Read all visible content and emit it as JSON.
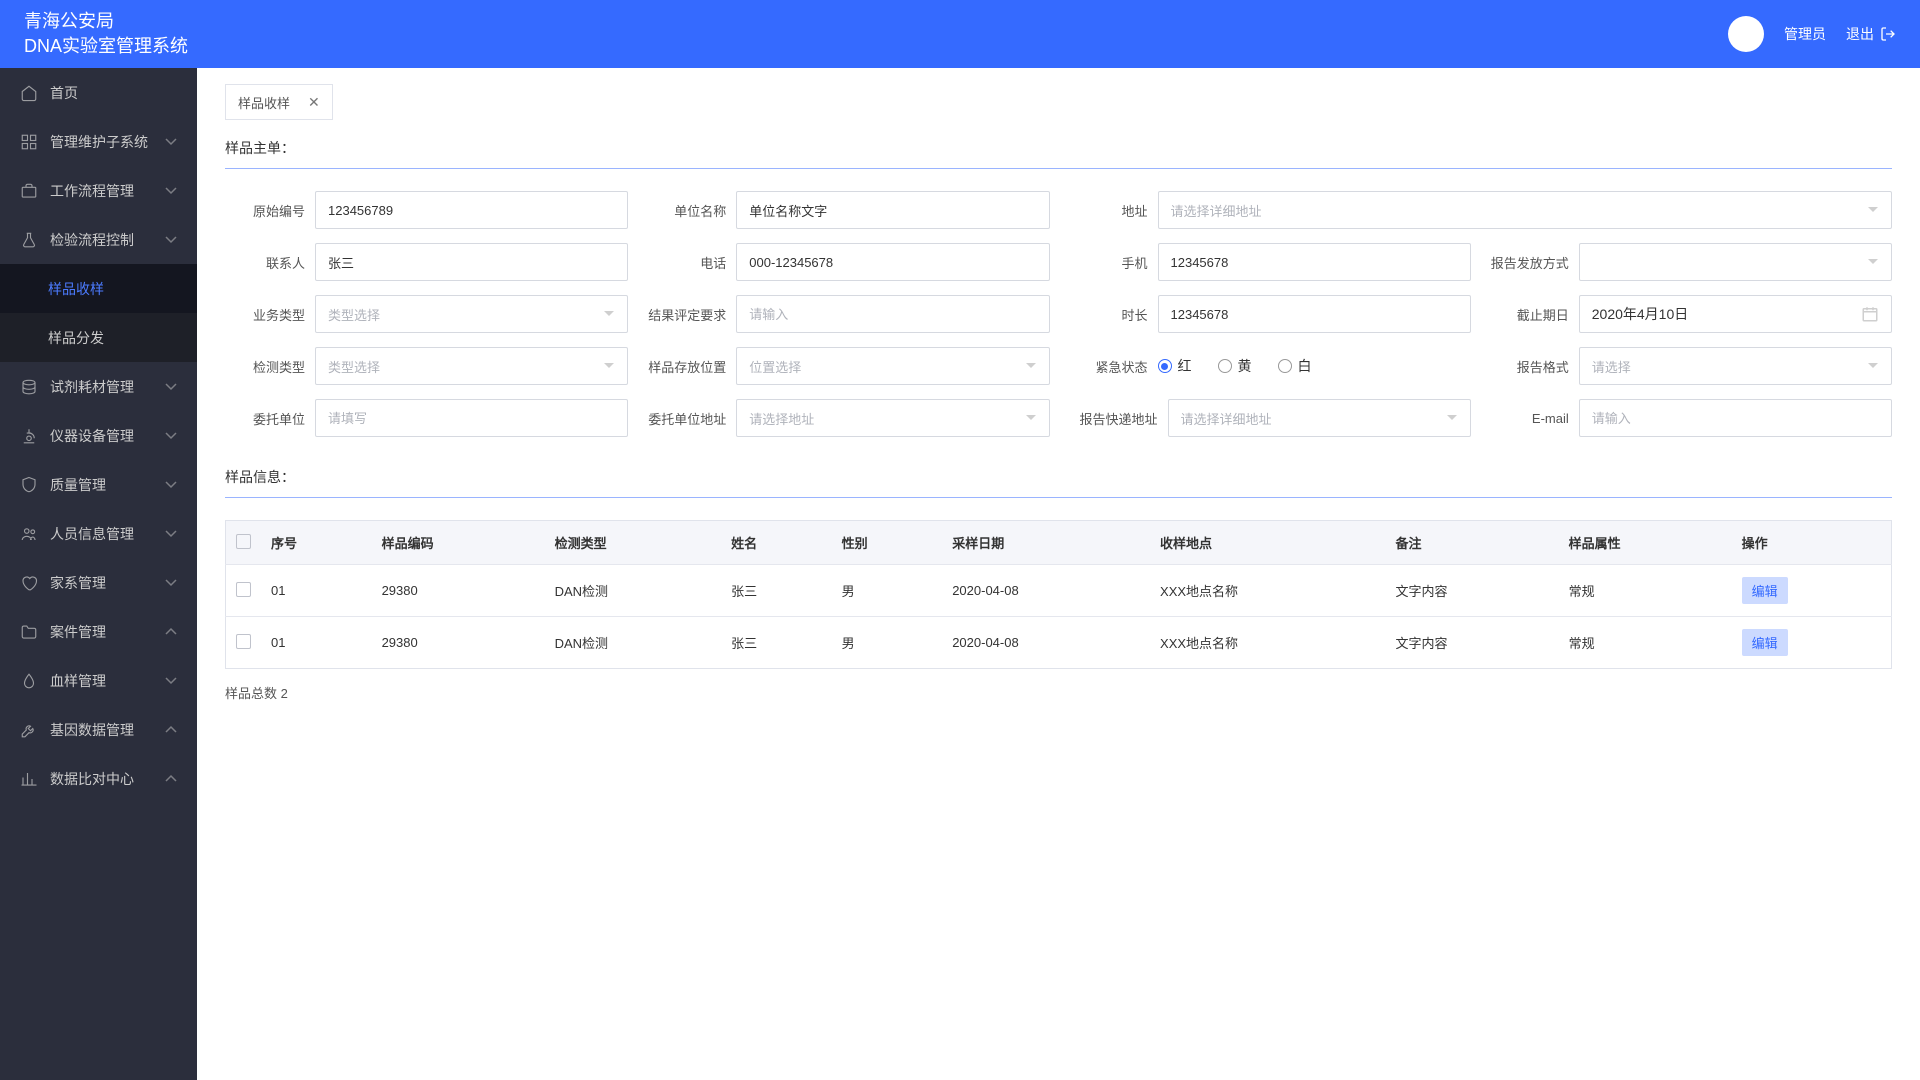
{
  "header": {
    "title_line1": "青海公安局",
    "title_line2": "DNA实验室管理系统",
    "user_role": "管理员",
    "logout": "退出"
  },
  "sidebar": {
    "items": [
      {
        "label": "首页",
        "icon": "home",
        "expandable": false
      },
      {
        "label": "管理维护子系统",
        "icon": "grid",
        "expandable": true,
        "chevron": "down"
      },
      {
        "label": "工作流程管理",
        "icon": "briefcase",
        "expandable": true,
        "chevron": "down"
      },
      {
        "label": "检验流程控制",
        "icon": "flask",
        "expandable": true,
        "chevron": "down",
        "expanded": true,
        "children": [
          {
            "label": "样品收样",
            "active": true
          },
          {
            "label": "样品分发"
          }
        ]
      },
      {
        "label": "试剂耗材管理",
        "icon": "stack",
        "expandable": true,
        "chevron": "down"
      },
      {
        "label": "仪器设备管理",
        "icon": "microscope",
        "expandable": true,
        "chevron": "down"
      },
      {
        "label": "质量管理",
        "icon": "shield",
        "expandable": true,
        "chevron": "down"
      },
      {
        "label": "人员信息管理",
        "icon": "users",
        "expandable": true,
        "chevron": "down"
      },
      {
        "label": "家系管理",
        "icon": "heart",
        "expandable": true,
        "chevron": "down"
      },
      {
        "label": "案件管理",
        "icon": "folder",
        "expandable": true,
        "chevron": "up"
      },
      {
        "label": "血样管理",
        "icon": "drop",
        "expandable": true,
        "chevron": "down"
      },
      {
        "label": "基因数据管理",
        "icon": "wrench",
        "expandable": true,
        "chevron": "up"
      },
      {
        "label": "数据比对中心",
        "icon": "chart",
        "expandable": true,
        "chevron": "up"
      }
    ]
  },
  "tab": {
    "label": "样品收样"
  },
  "section1_title": "样品主单：",
  "section2_title": "样品信息：",
  "form": {
    "original_no": {
      "label": "原始编号",
      "value": "123456789"
    },
    "unit_name": {
      "label": "单位名称",
      "value": "单位名称文字"
    },
    "address": {
      "label": "地址",
      "placeholder": "请选择详细地址"
    },
    "contact": {
      "label": "联系人",
      "value": "张三"
    },
    "phone": {
      "label": "电话",
      "value": "000-12345678"
    },
    "mobile": {
      "label": "手机",
      "value": "12345678"
    },
    "report_method": {
      "label": "报告发放方式",
      "placeholder": ""
    },
    "biz_type": {
      "label": "业务类型",
      "placeholder": "类型选择"
    },
    "result_req": {
      "label": "结果评定要求",
      "placeholder": "请输入"
    },
    "duration": {
      "label": "时长",
      "value": "12345678"
    },
    "deadline": {
      "label": "截止期日",
      "value": "2020年4月10日"
    },
    "test_type": {
      "label": "检测类型",
      "placeholder": "类型选择"
    },
    "storage": {
      "label": "样品存放位置",
      "placeholder": "位置选择"
    },
    "urgency": {
      "label": "紧急状态",
      "options": [
        "红",
        "黄",
        "白"
      ],
      "selected": "红"
    },
    "report_format": {
      "label": "报告格式",
      "placeholder": "请选择"
    },
    "entrust_unit": {
      "label": "委托单位",
      "placeholder": "请填写"
    },
    "entrust_addr": {
      "label": "委托单位地址",
      "placeholder": "请选择地址"
    },
    "express_addr": {
      "label": "报告快递地址",
      "placeholder": "请选择详细地址"
    },
    "email": {
      "label": "E-mail",
      "placeholder": "请输入"
    }
  },
  "table": {
    "headers": [
      "序号",
      "样品编码",
      "检测类型",
      "姓名",
      "性别",
      "采样日期",
      "收样地点",
      "备注",
      "样品属性",
      "操作"
    ],
    "rows": [
      {
        "no": "01",
        "code": "29380",
        "type": "DAN检测",
        "name": "张三",
        "gender": "男",
        "date": "2020-04-08",
        "location": "XXX地点名称",
        "remark": "文字内容",
        "attr": "常规",
        "action": "编辑"
      },
      {
        "no": "01",
        "code": "29380",
        "type": "DAN检测",
        "name": "张三",
        "gender": "男",
        "date": "2020-04-08",
        "location": "XXX地点名称",
        "remark": "文字内容",
        "attr": "常规",
        "action": "编辑"
      }
    ],
    "footer_label": "样品总数",
    "footer_count": "2"
  }
}
